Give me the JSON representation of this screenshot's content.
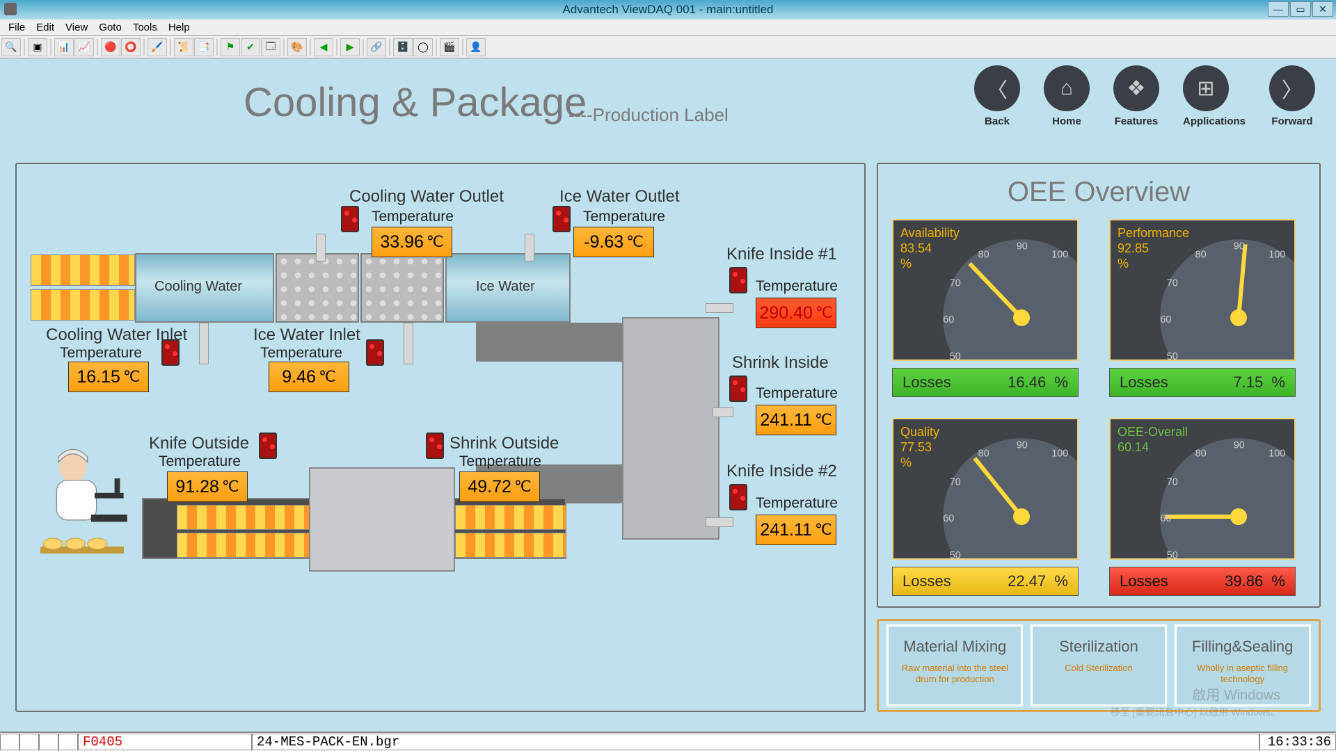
{
  "window": {
    "title": "Advantech ViewDAQ 001 - main:untitled"
  },
  "menu": {
    "file": "File",
    "edit": "Edit",
    "view": "View",
    "goto": "Goto",
    "tools": "Tools",
    "help": "Help"
  },
  "page": {
    "title": "Cooling & Package",
    "subtitle": "----Production Label"
  },
  "nav": {
    "back": "Back",
    "home": "Home",
    "features": "Features",
    "apps": "Applications",
    "fwd": "Forward"
  },
  "sections": {
    "coolingOutlet": "Cooling Water Outlet",
    "iceOutlet": "Ice Water Outlet",
    "coolingInlet": "Cooling Water Inlet",
    "iceInlet": "Ice Water Inlet",
    "knifeOutside": "Knife Outside",
    "shrinkOutside": "Shrink Outside",
    "knifeInside1": "Knife Inside #1",
    "shrinkInside": "Shrink Inside",
    "knifeInside2": "Knife Inside #2",
    "coolingWater": "Cooling Water",
    "iceWater": "Ice Water"
  },
  "labels": {
    "temperature": "Temperature"
  },
  "temps": {
    "coolingOutlet": {
      "value": "33.96",
      "unit": "℃"
    },
    "iceOutlet": {
      "value": "-9.63",
      "unit": "℃"
    },
    "coolingInlet": {
      "value": "16.15",
      "unit": "℃"
    },
    "iceInlet": {
      "value": "9.46",
      "unit": "℃"
    },
    "knifeOutside": {
      "value": "91.28",
      "unit": "℃"
    },
    "shrinkOutside": {
      "value": "49.72",
      "unit": "℃"
    },
    "knifeInside1": {
      "value": "290.40",
      "unit": "℃"
    },
    "shrinkInside": {
      "value": "241.11",
      "unit": "℃"
    },
    "knifeInside2": {
      "value": "241.11",
      "unit": "℃"
    }
  },
  "oee": {
    "title": "OEE Overview",
    "gauges": {
      "avail": {
        "name": "Availability",
        "value": "83.54",
        "pct": "%",
        "loss": "16.46",
        "lossLabel": "Losses",
        "color": "green"
      },
      "perf": {
        "name": "Performance",
        "value": "92.85",
        "pct": "%",
        "loss": "7.15",
        "lossLabel": "Losses",
        "color": "green"
      },
      "qual": {
        "name": "Quality",
        "value": "77.53",
        "pct": "%",
        "loss": "22.47",
        "lossLabel": "Losses",
        "color": "yellow"
      },
      "overall": {
        "name": "OEE-Overall",
        "value": "60.14",
        "pct": "",
        "loss": "39.86",
        "lossLabel": "Losses",
        "color": "red"
      }
    }
  },
  "cards": {
    "c1": {
      "title": "Material Mixing",
      "desc": "Raw material into the steel drum for production"
    },
    "c2": {
      "title": "Sterilization",
      "desc": "Cold Sterilization"
    },
    "c3": {
      "title": "Filling&Sealing",
      "desc": "Wholly in aseptic filling technology"
    }
  },
  "status": {
    "code": "F0405",
    "file": "24-MES-PACK-EN.bgr",
    "clock": "16:33:36"
  },
  "watermark": {
    "l1": "啟用 Windows",
    "l2": "移至 [重要訊息中心] 以啟用 Windows。"
  },
  "chart_data": {
    "type": "table",
    "title": "OEE Overview gauges",
    "series": [
      {
        "name": "Availability",
        "value": 83.54,
        "loss": 16.46,
        "range": [
          50,
          100
        ]
      },
      {
        "name": "Performance",
        "value": 92.85,
        "loss": 7.15,
        "range": [
          50,
          100
        ]
      },
      {
        "name": "Quality",
        "value": 77.53,
        "loss": 22.47,
        "range": [
          50,
          100
        ]
      },
      {
        "name": "OEE-Overall",
        "value": 60.14,
        "loss": 39.86,
        "range": [
          50,
          100
        ]
      }
    ],
    "ticks": [
      50,
      60,
      70,
      80,
      90,
      100
    ]
  }
}
